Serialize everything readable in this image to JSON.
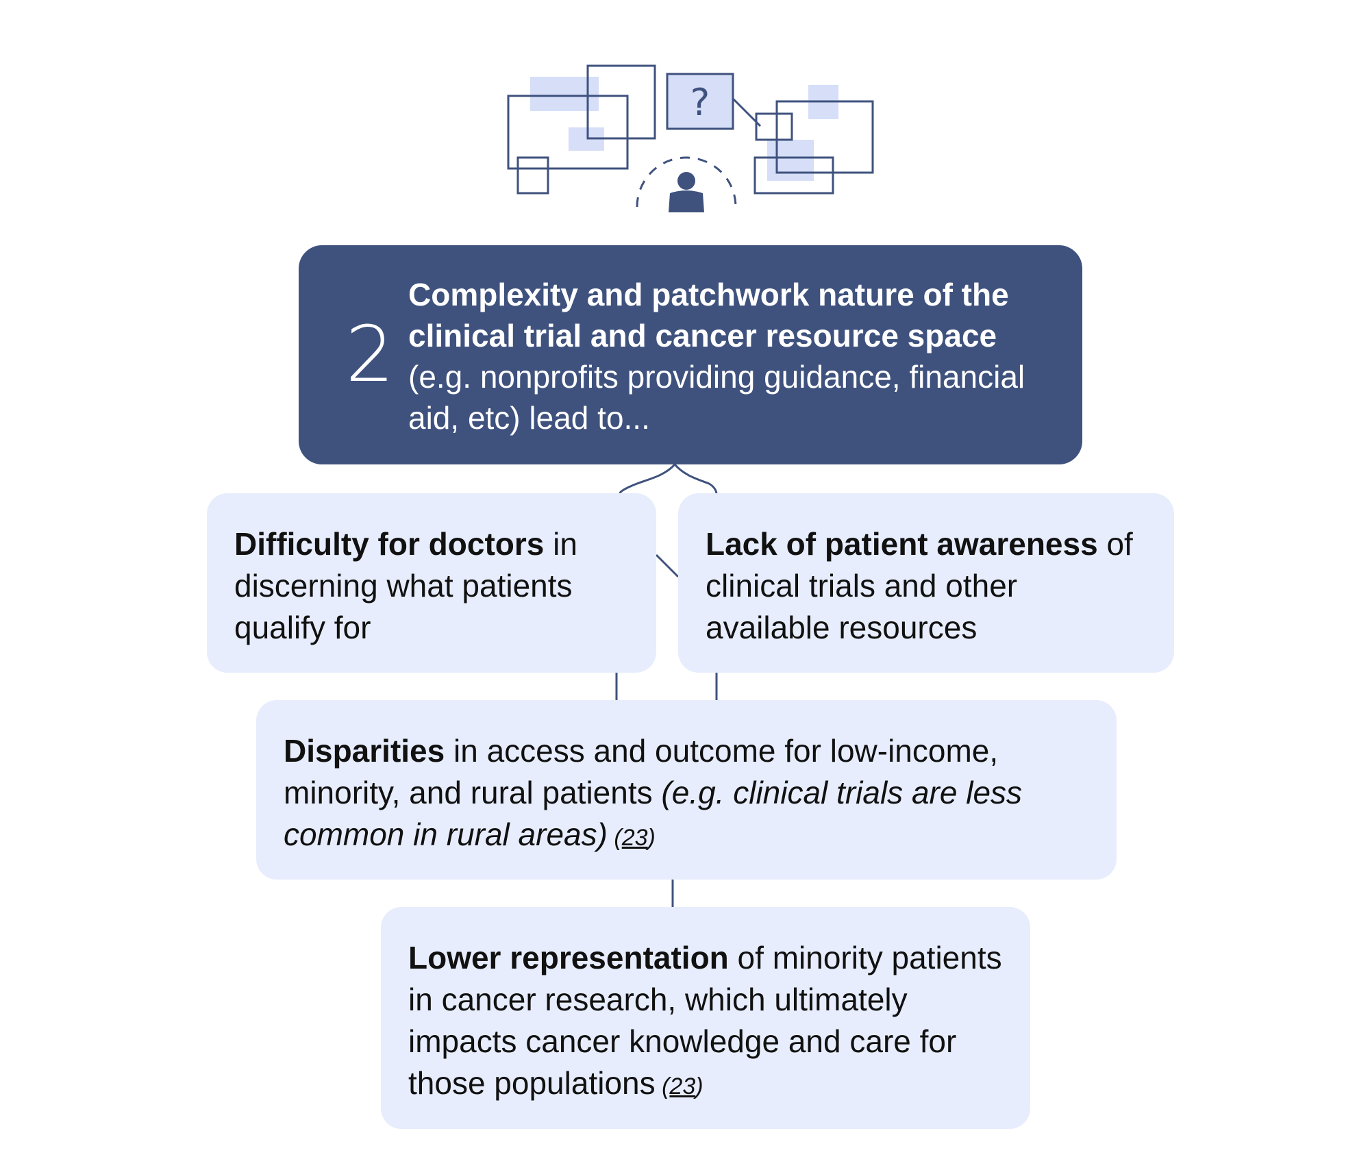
{
  "colors": {
    "navy": "#3f527e",
    "box_fill": "#e7edfc",
    "illustration_fill": "#d6def8",
    "text": "#111111"
  },
  "illustration": {
    "icons": [
      "overlapping-windows-icon",
      "question-bubble-icon",
      "person-icon"
    ],
    "question_mark": "?"
  },
  "header": {
    "number": "2",
    "bold_text": "Complexity and patchwork nature of the clinical trial and cancer resource space",
    "regular_text": " (e.g. nonprofits providing guidance, financial aid, etc) lead to..."
  },
  "doctors": {
    "bold_text": "Difficulty for doctors",
    "regular_text": " in discerning what patients qualify for"
  },
  "awareness": {
    "bold_text": "Lack of patient awareness",
    "regular_text": " of clinical trials and other available resources"
  },
  "disparities": {
    "bold_text": "Disparities",
    "regular_text": " in access and outcome for low-income, minority, and rural patients ",
    "italic_text": "(e.g. clinical trials are less common in rural areas)",
    "citation_open": " (",
    "citation_number": "23",
    "citation_close": ")"
  },
  "representation": {
    "bold_text": "Lower representation",
    "regular_text": " of minority patients in cancer research, which ultimately impacts cancer knowledge and care for those populations",
    "citation_open": " (",
    "citation_number": "23",
    "citation_close": ")"
  }
}
